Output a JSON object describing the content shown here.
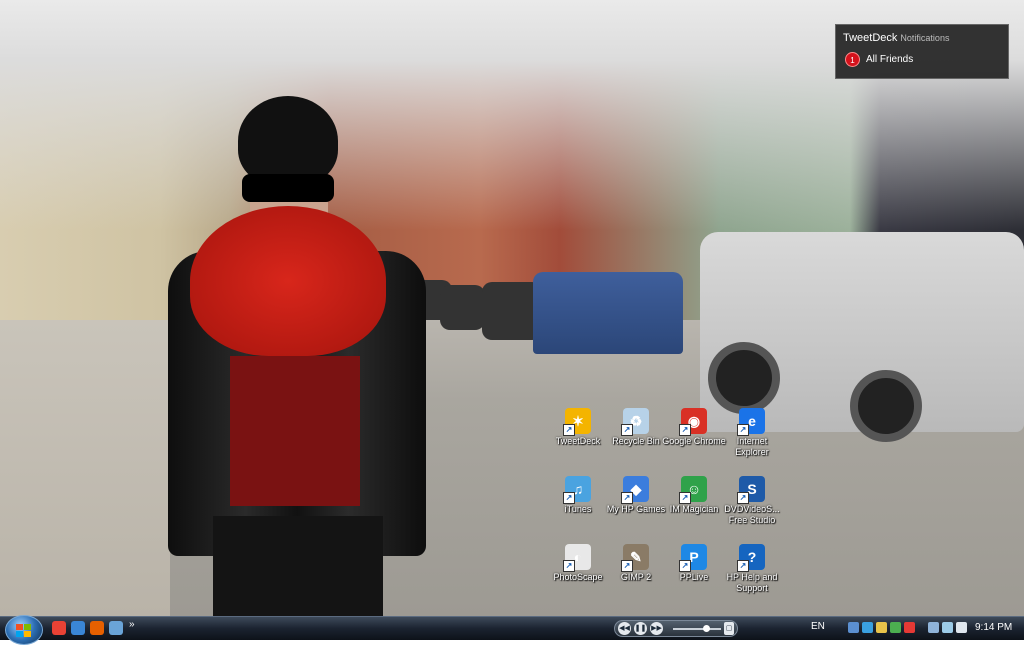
{
  "notification": {
    "app": "TweetDeck",
    "subtitle": "Notifications",
    "badge_count": "1",
    "item": "All Friends"
  },
  "desktop_icons": [
    {
      "label": "TweetDeck",
      "icon": "tweetdeck-icon",
      "color": "#f4b400",
      "glyph": "✶"
    },
    {
      "label": "Recycle Bin",
      "icon": "recycle-bin-icon",
      "color": "#b7d2e8",
      "glyph": "♻"
    },
    {
      "label": "Google Chrome",
      "icon": "chrome-icon",
      "color": "#d93025",
      "glyph": "◉"
    },
    {
      "label": "Internet Explorer",
      "icon": "internet-explorer-icon",
      "color": "#1a73e8",
      "glyph": "e"
    },
    {
      "label": "iTunes",
      "icon": "itunes-icon",
      "color": "#4aa3e0",
      "glyph": "♫"
    },
    {
      "label": "My HP Games",
      "icon": "hp-games-icon",
      "color": "#3b7ddd",
      "glyph": "◆"
    },
    {
      "label": "IM Magician",
      "icon": "im-magician-icon",
      "color": "#2fa24a",
      "glyph": "☺"
    },
    {
      "label": "DVDVideoS... Free Studio",
      "icon": "dvdvideosoft-icon",
      "color": "#1e5aa8",
      "glyph": "S"
    },
    {
      "label": "PhotoScape",
      "icon": "photoscape-icon",
      "color": "#e8e8e8",
      "glyph": "◐"
    },
    {
      "label": "GIMP 2",
      "icon": "gimp-icon",
      "color": "#8a7b66",
      "glyph": "✎"
    },
    {
      "label": "PPLive",
      "icon": "pplive-icon",
      "color": "#1e88e5",
      "glyph": "P"
    },
    {
      "label": "HP Help and Support",
      "icon": "hp-help-icon",
      "color": "#1565c0",
      "glyph": "?"
    }
  ],
  "taskbar": {
    "quick_launch": [
      {
        "icon": "chrome-quicklaunch-icon",
        "color": "#e94235"
      },
      {
        "icon": "ie-quicklaunch-icon",
        "color": "#3a86d6"
      },
      {
        "icon": "firefox-quicklaunch-icon",
        "color": "#e66000"
      },
      {
        "icon": "show-desktop-icon",
        "color": "#6aa4d8"
      }
    ],
    "more_label": "»",
    "language": "EN",
    "clock": "9:14 PM",
    "tray_icons": [
      {
        "icon": "tray-app-1-icon",
        "color": "#5b8fd0"
      },
      {
        "icon": "tray-app-2-icon",
        "color": "#3aa0e0"
      },
      {
        "icon": "tray-mail-icon",
        "color": "#e8c34a"
      },
      {
        "icon": "tray-messenger-icon",
        "color": "#4caf50"
      },
      {
        "icon": "tray-alert-icon",
        "color": "#e53935"
      },
      {
        "icon": "tray-network-icon",
        "color": "#8fb3d9"
      },
      {
        "icon": "tray-monitor-icon",
        "color": "#9ccbe8"
      },
      {
        "icon": "tray-volume-icon",
        "color": "#dfe6ee"
      }
    ]
  }
}
